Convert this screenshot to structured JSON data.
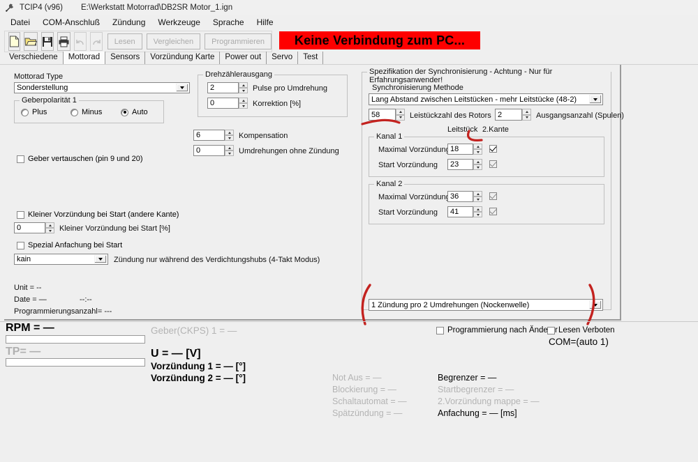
{
  "window": {
    "app_title": "TCIP4 (v96)",
    "file_path": "E:\\Werkstatt Motorrad\\DB2SR Motor_1.ign",
    "icon": "wrench-icon"
  },
  "menu": {
    "items": [
      {
        "label": "Datei"
      },
      {
        "label": "COM-Anschluß"
      },
      {
        "label": "Zündung"
      },
      {
        "label": "Werkzeuge"
      },
      {
        "label": "Sprache"
      },
      {
        "label": "Hilfe"
      }
    ]
  },
  "toolbar": {
    "icons": [
      {
        "name": "new-file-icon"
      },
      {
        "name": "open-folder-icon"
      },
      {
        "name": "save-disk-icon"
      },
      {
        "name": "print-icon"
      },
      {
        "name": "undo-icon"
      },
      {
        "name": "redo-icon"
      }
    ],
    "buttons": [
      {
        "label": "Lesen",
        "enabled": false
      },
      {
        "label": "Vergleichen",
        "enabled": false
      },
      {
        "label": "Programmieren",
        "enabled": false
      }
    ],
    "status_banner": {
      "text": "Keine Verbindung zum PC...",
      "bg_color": "#fe0000",
      "text_color": "#000000"
    }
  },
  "tabs": {
    "items": [
      {
        "label": "Verschiedene",
        "active": false
      },
      {
        "label": "Mottorad",
        "active": true
      },
      {
        "label": "Sensors",
        "active": false
      },
      {
        "label": "Vorzündung Karte",
        "active": false
      },
      {
        "label": "Power out",
        "active": false
      },
      {
        "label": "Servo",
        "active": false
      },
      {
        "label": "Test",
        "active": false
      }
    ]
  },
  "left_panel": {
    "motorrad_type_label": "Mottorad Type",
    "motorrad_type_value": "Sonderstellung",
    "geberpolaritaet": {
      "legend": "Geberpolarität 1",
      "options": [
        {
          "label": "Plus",
          "selected": false
        },
        {
          "label": "Minus",
          "selected": false
        },
        {
          "label": "Auto",
          "selected": true
        }
      ]
    },
    "geber_vertauschen": {
      "label": "Geber vertauschen (pin 9 und 20)",
      "checked": false
    },
    "kleiner_vorzuendung_kante": {
      "label": "Kleiner Vorzündung bei Start (andere Kante)",
      "checked": false
    },
    "kleiner_vorzuendung_percent": {
      "label": "Kleiner Vorzündung bei Start [%]",
      "value": "0"
    },
    "spezial_anfachung": {
      "label": "Spezial Anfachung bei Start",
      "checked": false
    },
    "takt_modus_value": "kain",
    "takt_modus_label": "Zündung nur während des Verdichtungshubs (4-Takt Modus)",
    "info": {
      "unit": "Unit = --",
      "date": "Date = —",
      "time": "--:--",
      "prog_count": "Programmierungsanzahl= ---"
    }
  },
  "drehzaehler": {
    "legend": "Drehzählerausgang",
    "pulse": {
      "label": "Pulse pro Umdrehung",
      "value": "2"
    },
    "korrektion": {
      "label": "Korrektion [%]",
      "value": "0"
    },
    "kompensation": {
      "label": "Kompensation",
      "value": "6"
    },
    "umdrehungen_ohne_zuendung": {
      "label": "Umdrehungen ohne Zündung",
      "value": "0"
    }
  },
  "sync_panel": {
    "legend": "Spezifikation der Synchronisierung - Achtung - Nur für Erfahrungsanwender!",
    "method_label": "Synchronisierung Methode",
    "method_value": "Lang Abstand zwischen Leitstücken - mehr Leitstücke (48-2)",
    "leitstueckzahl": {
      "label": "Leistückzahl des Rotors",
      "value": "58"
    },
    "ausgangsanzahl": {
      "label": "Ausgangsanzahl (Spulen)",
      "value": "2"
    },
    "col_header_left": "Leitstück",
    "col_header_right": "2.Kante",
    "kanal1": {
      "legend": "Kanal 1",
      "rows": [
        {
          "label": "Maximal Vorzündung",
          "value": "18",
          "checked": true,
          "disabled": false
        },
        {
          "label": "Start Vorzündung",
          "value": "23",
          "checked": true,
          "disabled": true
        }
      ]
    },
    "kanal2": {
      "legend": "Kanal 2",
      "rows": [
        {
          "label": "Maximal Vorzündung",
          "value": "36",
          "checked": true,
          "disabled": true
        },
        {
          "label": "Start Vorzündung",
          "value": "41",
          "checked": true,
          "disabled": true
        }
      ]
    },
    "zuendung_mode_value": "1 Zündung pro 2 Umdrehungen (Nockenwelle)"
  },
  "bottom": {
    "rpm_label": "RPM = —",
    "tp_label": "TP= —",
    "geber_ckps_label": "Geber(CKPS) 1 = —",
    "voltage_label": "U = — [V]",
    "vorzuendung1_label": "Vorzündung 1 = — [°]",
    "vorzuendung2_label": "Vorzündung 2 = — [°]",
    "prog_nach_aenderung": {
      "label": "Programmierung nach Änderur",
      "checked": false
    },
    "lesen_verboten": {
      "label": "Lesen Verboten",
      "checked": false
    },
    "com_label": "COM=(auto 1)",
    "status_left": [
      {
        "label": "Not Aus = —",
        "active": false
      },
      {
        "label": "Blockierung = —",
        "active": false
      },
      {
        "label": "Schaltautomat = —",
        "active": false
      },
      {
        "label": "Spätzündung = —",
        "active": false
      }
    ],
    "status_right": [
      {
        "label": "Begrenzer = —",
        "active": true
      },
      {
        "label": "Startbegrenzer = —",
        "active": false
      },
      {
        "label": "2.Vorzündung mappe = —",
        "active": false
      },
      {
        "label": "Anfachung = — [ms]",
        "active": true
      }
    ]
  },
  "annotations": {
    "color": "#c3221f",
    "marks": [
      "underline-leitstueckzahl",
      "underline-2kante",
      "bracket-left-zuendung-mode",
      "bracket-right-zuendung-mode"
    ]
  }
}
